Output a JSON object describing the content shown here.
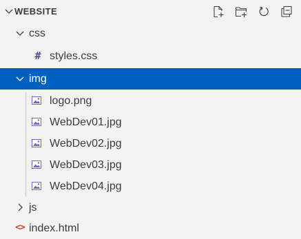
{
  "explorer": {
    "title": "WEBSITE",
    "actions": [
      {
        "icon": "new-file-icon",
        "label": "New File"
      },
      {
        "icon": "new-folder-icon",
        "label": "New Folder"
      },
      {
        "icon": "refresh-icon",
        "label": "Refresh Explorer"
      },
      {
        "icon": "collapse-all-icon",
        "label": "Collapse Folders in Explorer"
      }
    ],
    "tree": [
      {
        "label": "css",
        "type": "folder",
        "expanded": true,
        "depth": 1
      },
      {
        "label": "styles.css",
        "type": "file",
        "icon": "css-hash-icon",
        "depth": 2
      },
      {
        "label": "img",
        "type": "folder",
        "expanded": true,
        "depth": 1,
        "selected": true
      },
      {
        "label": "logo.png",
        "type": "file",
        "icon": "image-file-icon",
        "depth": 2
      },
      {
        "label": "WebDev01.jpg",
        "type": "file",
        "icon": "image-file-icon",
        "depth": 2
      },
      {
        "label": "WebDev02.jpg",
        "type": "file",
        "icon": "image-file-icon",
        "depth": 2
      },
      {
        "label": "WebDev03.jpg",
        "type": "file",
        "icon": "image-file-icon",
        "depth": 2
      },
      {
        "label": "WebDev04.jpg",
        "type": "file",
        "icon": "image-file-icon",
        "depth": 2
      },
      {
        "label": "js",
        "type": "folder",
        "expanded": false,
        "depth": 1
      },
      {
        "label": "index.html",
        "type": "file",
        "icon": "html-brackets-icon",
        "depth": 1
      }
    ],
    "colors": {
      "background": "#f3f3f3",
      "selection": "#0060c0",
      "selection_text": "#ffffff",
      "text": "#3c3c3c",
      "css_icon": "#4f4f8f",
      "html_icon": "#c24a2d",
      "image_icon": "#6b6bb8"
    }
  }
}
